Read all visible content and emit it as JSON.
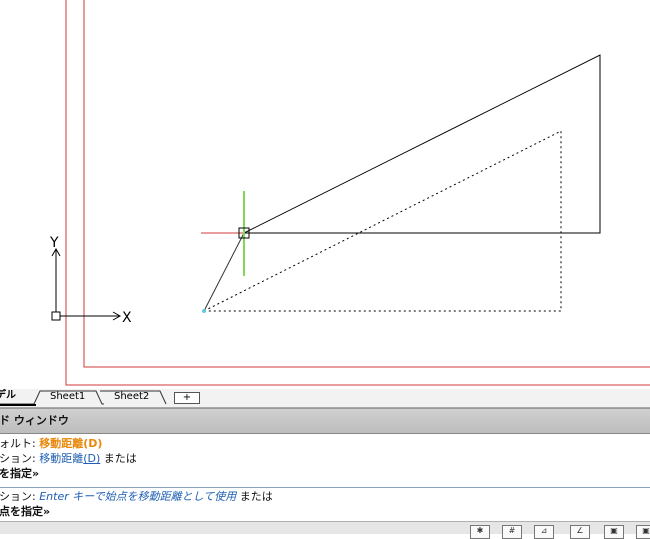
{
  "tabs": {
    "model": "デル",
    "sheet1": "Sheet1",
    "sheet2": "Sheet2",
    "add_symbol": "+"
  },
  "ucs": {
    "y_label": "Y",
    "x_label": "X"
  },
  "command_window": {
    "title": "ンド ウィンドウ",
    "line1_prefix": "フォルト: ",
    "line1_value": "移動距離(D)",
    "line2_prefix": "ジション: ",
    "line2_option": "移動距離",
    "line2_option_key": "(D)",
    "line2_suffix": " または",
    "line3": "点を指定»",
    "line4_prefix": "ジション: ",
    "line4_hint": "Enter キーで始点を移動距離として使用",
    "line4_suffix": " または",
    "line5": "的点を指定»"
  },
  "colors": {
    "border_red": "#d23a3a",
    "crosshair_green": "#7ed957",
    "crosshair_red": "#d23a3a",
    "base_point_cyan": "#5ecbe0",
    "option_orange": "#e8890c",
    "option_blue": "#1f5fb4"
  }
}
